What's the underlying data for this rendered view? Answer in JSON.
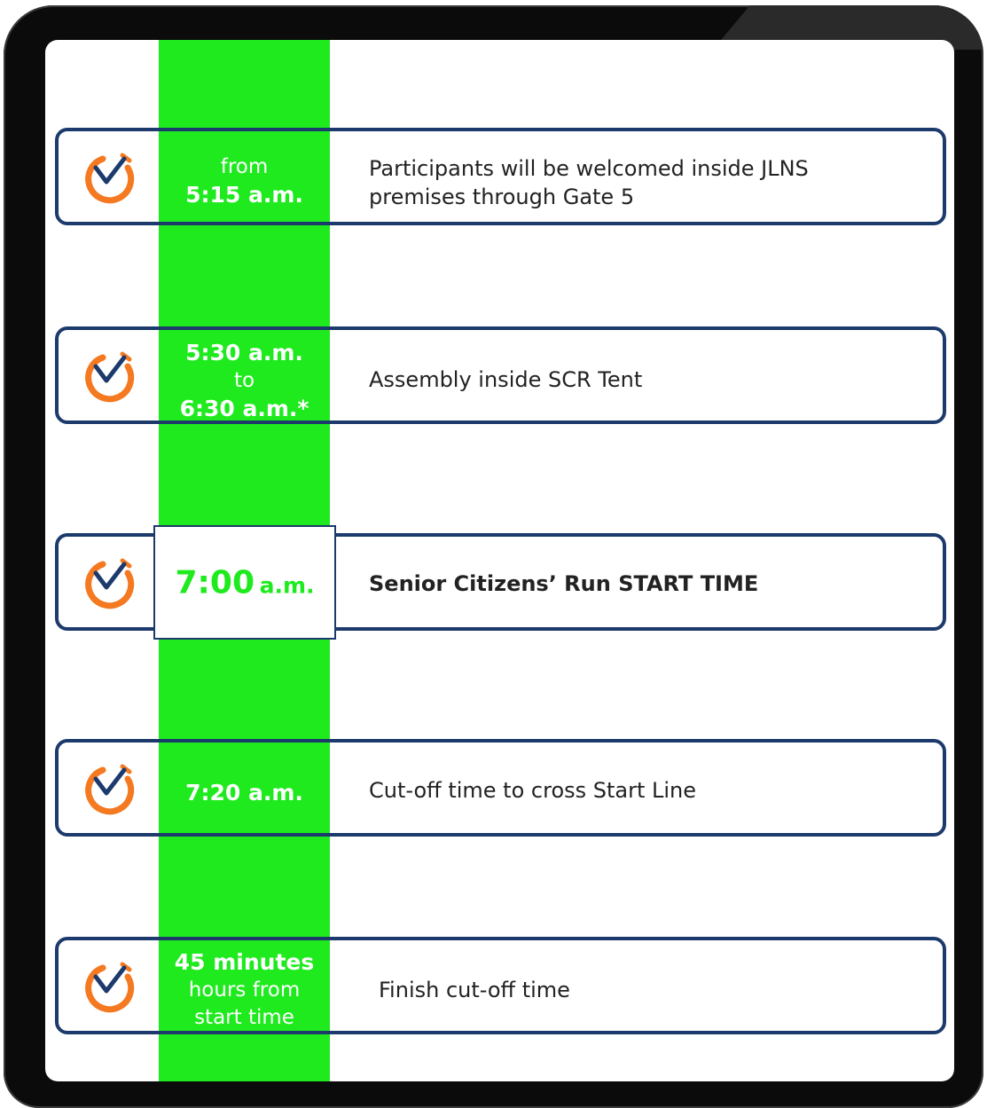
{
  "colors": {
    "accent_green": "#1eea1e",
    "border_navy": "#1c3a6b",
    "icon_orange": "#f47920",
    "icon_check": "#1c3a6b"
  },
  "schedule": [
    {
      "icon": "stopwatch-check-icon",
      "time_pre": "from",
      "time_main": "5:15 a.m.",
      "description_line1": "Participants will be welcomed inside JLNS",
      "description_line2": "premises through Gate 5"
    },
    {
      "icon": "stopwatch-check-icon",
      "time_main": "5:30 a.m.",
      "time_mid": "to",
      "time_end": "6:30 a.m.*",
      "description": "Assembly inside SCR Tent"
    },
    {
      "icon": "stopwatch-check-icon",
      "time_hour": "7:00",
      "time_suffix": "a.m.",
      "description": "Senior Citizens’ Run START TIME"
    },
    {
      "icon": "stopwatch-check-icon",
      "time_main": "7:20 a.m.",
      "description": "Cut-off time to cross Start Line"
    },
    {
      "icon": "stopwatch-check-icon",
      "time_main": "45 minutes",
      "time_line2": "hours from",
      "time_line3": "start time",
      "description": "Finish cut-off time"
    }
  ]
}
